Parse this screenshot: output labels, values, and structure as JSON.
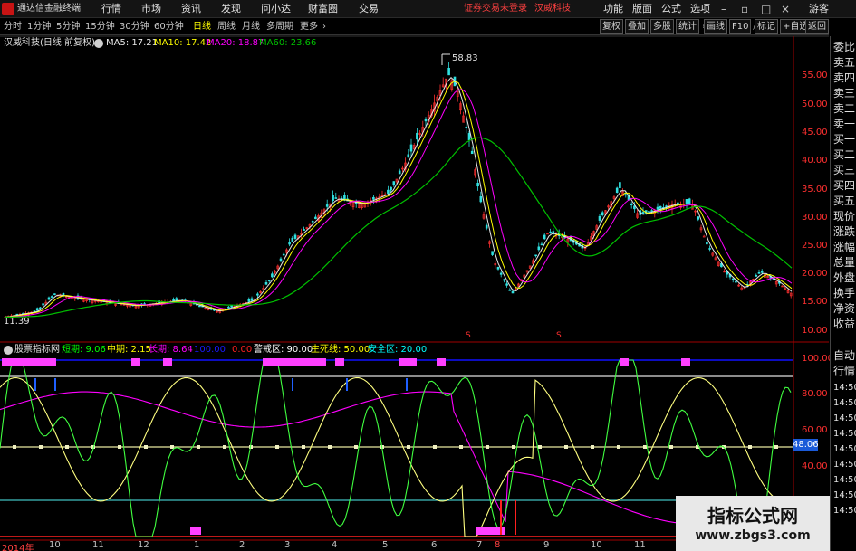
{
  "app": {
    "title": "通达信金融终端"
  },
  "menu": {
    "items": [
      "行情",
      "市场",
      "资讯",
      "发现",
      "问小达",
      "财富圈",
      "交易"
    ],
    "notice": "证券交易未登录",
    "stock_name": "汉威科技",
    "tools": [
      "功能",
      "版面",
      "公式",
      "选项"
    ],
    "guest": "游客"
  },
  "periods": [
    "分时",
    "1分钟",
    "5分钟",
    "15分钟",
    "30分钟",
    "60分钟",
    "日线",
    "周线",
    "月线",
    "多周期",
    "更多"
  ],
  "active_period": "日线",
  "toolbar_right": [
    "复权",
    "叠加",
    "多股",
    "统计",
    "画线",
    "F10",
    "标记",
    "+自选",
    "返回"
  ],
  "main_legend": {
    "title": "汉威科技(日线 前复权)",
    "ma": [
      {
        "label": "MA5: 17.21",
        "color": "#e8e8e8"
      },
      {
        "label": "MA10: 17.42",
        "color": "#ffff00"
      },
      {
        "label": "MA20: 18.87",
        "color": "#ff00ff"
      },
      {
        "label": "MA60: 23.66",
        "color": "#00c000"
      }
    ]
  },
  "price_axis": [
    "55.00",
    "50.00",
    "45.00",
    "40.00",
    "35.00",
    "30.00",
    "25.00",
    "20.00",
    "15.00",
    "10.00"
  ],
  "price_range": {
    "min": 10,
    "max": 59
  },
  "high_label": "58.83",
  "low_label": "11.39",
  "markers": [
    "S",
    "S"
  ],
  "indicator": {
    "name": "股票指标网",
    "items": [
      {
        "label": "短期: 9.06",
        "color": "#00ff00"
      },
      {
        "label": "中期: 2.15",
        "color": "#ffff00"
      },
      {
        "label": "长期: 8.64",
        "color": "#ff00ff"
      },
      {
        "label": "100.00",
        "color": "#0000ff"
      },
      {
        "label": "0.00",
        "color": "#ff0000"
      },
      {
        "label": "警戒区: 90.00",
        "color": "#ffffff"
      },
      {
        "label": "生死线: 50.00",
        "color": "#ffff00"
      },
      {
        "label": "安全区: 20.00",
        "color": "#00ffff"
      }
    ],
    "axis": [
      "100.00",
      "80.00",
      "60.00",
      "40.00"
    ],
    "current_value": "48.06"
  },
  "date_axis": [
    "2014年",
    "10",
    "11",
    "12",
    "1",
    "2",
    "3",
    "4",
    "5",
    "6",
    "7",
    "8",
    "9",
    "10",
    "11",
    "12"
  ],
  "sidebar": [
    "委比",
    "卖五",
    "卖四",
    "卖三",
    "卖二",
    "卖一",
    "买一",
    "买二",
    "买三",
    "买四",
    "买五",
    "现价",
    "涨跌",
    "涨幅",
    "总量",
    "外盘",
    "换手",
    "净资",
    "收益",
    "自动",
    "行情"
  ],
  "time_col": [
    "14:50",
    "14:50",
    "14:50",
    "14:50",
    "14:50",
    "14:50",
    "14:50",
    "14:50",
    "14:50"
  ],
  "watermark": {
    "title": "指标公式网",
    "url": "www.zbgs3.com"
  }
}
